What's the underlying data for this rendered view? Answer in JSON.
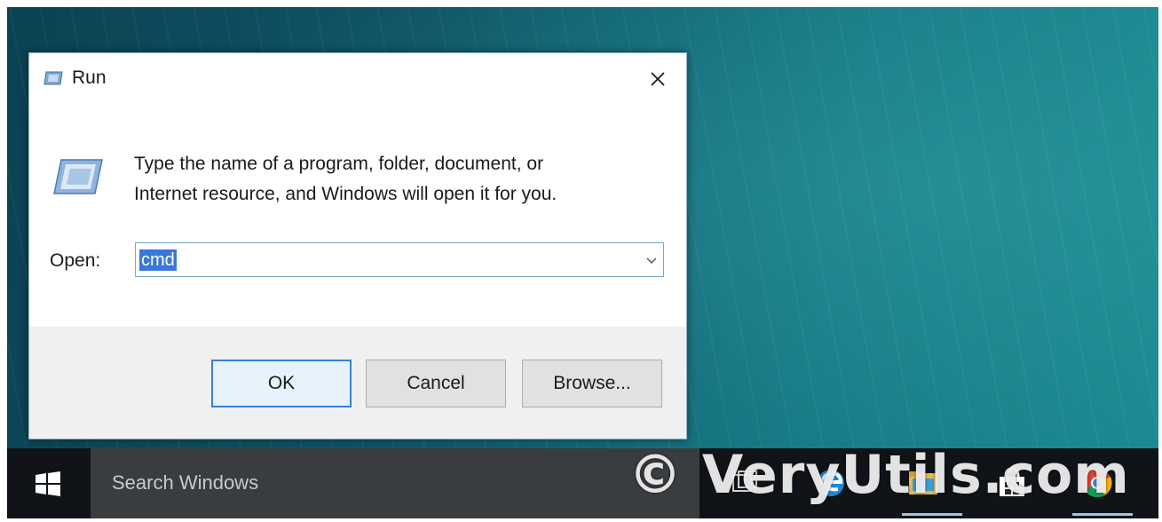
{
  "window": {
    "title": "Run",
    "close_label": "×"
  },
  "description": {
    "line1": "Type the name of a program, folder, document, or",
    "line2": "Internet resource, and Windows will open it for you."
  },
  "open_field": {
    "label": "Open:",
    "value": "cmd"
  },
  "buttons": {
    "ok": "OK",
    "cancel": "Cancel",
    "browse": "Browse..."
  },
  "taskbar": {
    "search_placeholder": "Search Windows",
    "icons": [
      "start-windows-icon",
      "task-view-icon",
      "edge-icon",
      "file-explorer-icon",
      "store-icon",
      "chrome-icon"
    ]
  },
  "watermark": {
    "text": "© VeryUtils.com"
  },
  "colors": {
    "accent": "#3c7fd1",
    "selection": "#3b78d6",
    "taskbar": "#101418",
    "search_box": "#3a3d40"
  }
}
